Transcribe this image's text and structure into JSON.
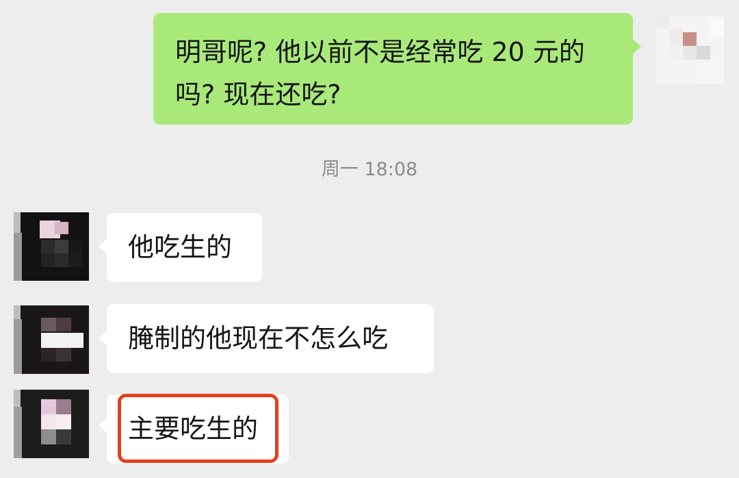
{
  "messages": [
    {
      "side": "outgoing",
      "line1": "明哥呢? 他以前不是经常吃 20 元的",
      "line2": "吗? 现在还吃?"
    },
    {
      "side": "incoming",
      "text": "他吃生的"
    },
    {
      "side": "incoming",
      "text": "腌制的他现在不怎么吃"
    },
    {
      "side": "incoming",
      "text": "主要吃生的",
      "highlighted": true
    }
  ],
  "timestamp": "周一 18:08",
  "colors": {
    "background": "#ededed",
    "outgoing_bubble": "#a9e97a",
    "incoming_bubble": "#ffffff",
    "highlight_border": "#e3401f",
    "timestamp_text": "#8b8b8b"
  }
}
